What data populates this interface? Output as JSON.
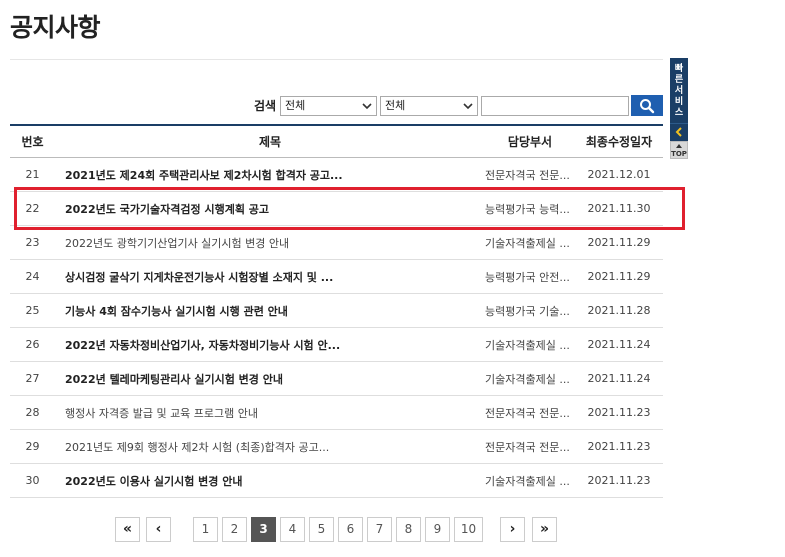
{
  "page": {
    "title": "공지사항"
  },
  "search": {
    "label": "검색",
    "select1_value": "전체",
    "select2_value": "전체",
    "input_value": ""
  },
  "table": {
    "headers": {
      "no": "번호",
      "title": "제목",
      "dept": "담당부서",
      "date": "최종수정일자"
    },
    "rows": [
      {
        "no": "21",
        "title": "2021년도 제24회 주택관리사보 제2차시험 합격자 공고...",
        "dept": "전문자격국 전문...",
        "date": "2021.12.01",
        "bold": true
      },
      {
        "no": "22",
        "title": "2022년도 국가기술자격검정 시행계획 공고",
        "dept": "능력평가국 능력...",
        "date": "2021.11.30",
        "bold": true
      },
      {
        "no": "23",
        "title": "2022년도 광학기기산업기사 실기시험 변경 안내",
        "dept": "기술자격출제실 ...",
        "date": "2021.11.29",
        "bold": false
      },
      {
        "no": "24",
        "title": "상시검정 굴삭기 지게차운전기능사 시험장별 소재지 및 ...",
        "dept": "능력평가국 안전...",
        "date": "2021.11.29",
        "bold": true
      },
      {
        "no": "25",
        "title": "기능사 4회 잠수기능사 실기시험 시행 관련 안내",
        "dept": "능력평가국 기술...",
        "date": "2021.11.28",
        "bold": true
      },
      {
        "no": "26",
        "title": "2022년 자동차정비산업기사, 자동차정비기능사 시험 안...",
        "dept": "기술자격출제실 ...",
        "date": "2021.11.24",
        "bold": true
      },
      {
        "no": "27",
        "title": "2022년 텔레마케팅관리사 실기시험 변경 안내",
        "dept": "기술자격출제실 ...",
        "date": "2021.11.24",
        "bold": true
      },
      {
        "no": "28",
        "title": "행정사 자격증 발급 및 교육 프로그램 안내",
        "dept": "전문자격국 전문...",
        "date": "2021.11.23",
        "bold": false
      },
      {
        "no": "29",
        "title": "2021년도 제9회 행정사 제2차 시험 (최종)합격자 공고...",
        "dept": "전문자격국 전문...",
        "date": "2021.11.23",
        "bold": false
      },
      {
        "no": "30",
        "title": "2022년도 이용사 실기시험 변경 안내",
        "dept": "기술자격출제실 ...",
        "date": "2021.11.23",
        "bold": true
      }
    ]
  },
  "pagination": {
    "first": "«",
    "prev": "‹",
    "pages": [
      "1",
      "2",
      "3",
      "4",
      "5",
      "6",
      "7",
      "8",
      "9",
      "10"
    ],
    "current": "3",
    "next": "›",
    "last": "»"
  },
  "quick_service": {
    "label": "빠른서비스",
    "top_label": "TOP"
  },
  "colors": {
    "accent": "#1f5fb0",
    "navy": "#1a3e66",
    "highlight": "#e0202e"
  }
}
